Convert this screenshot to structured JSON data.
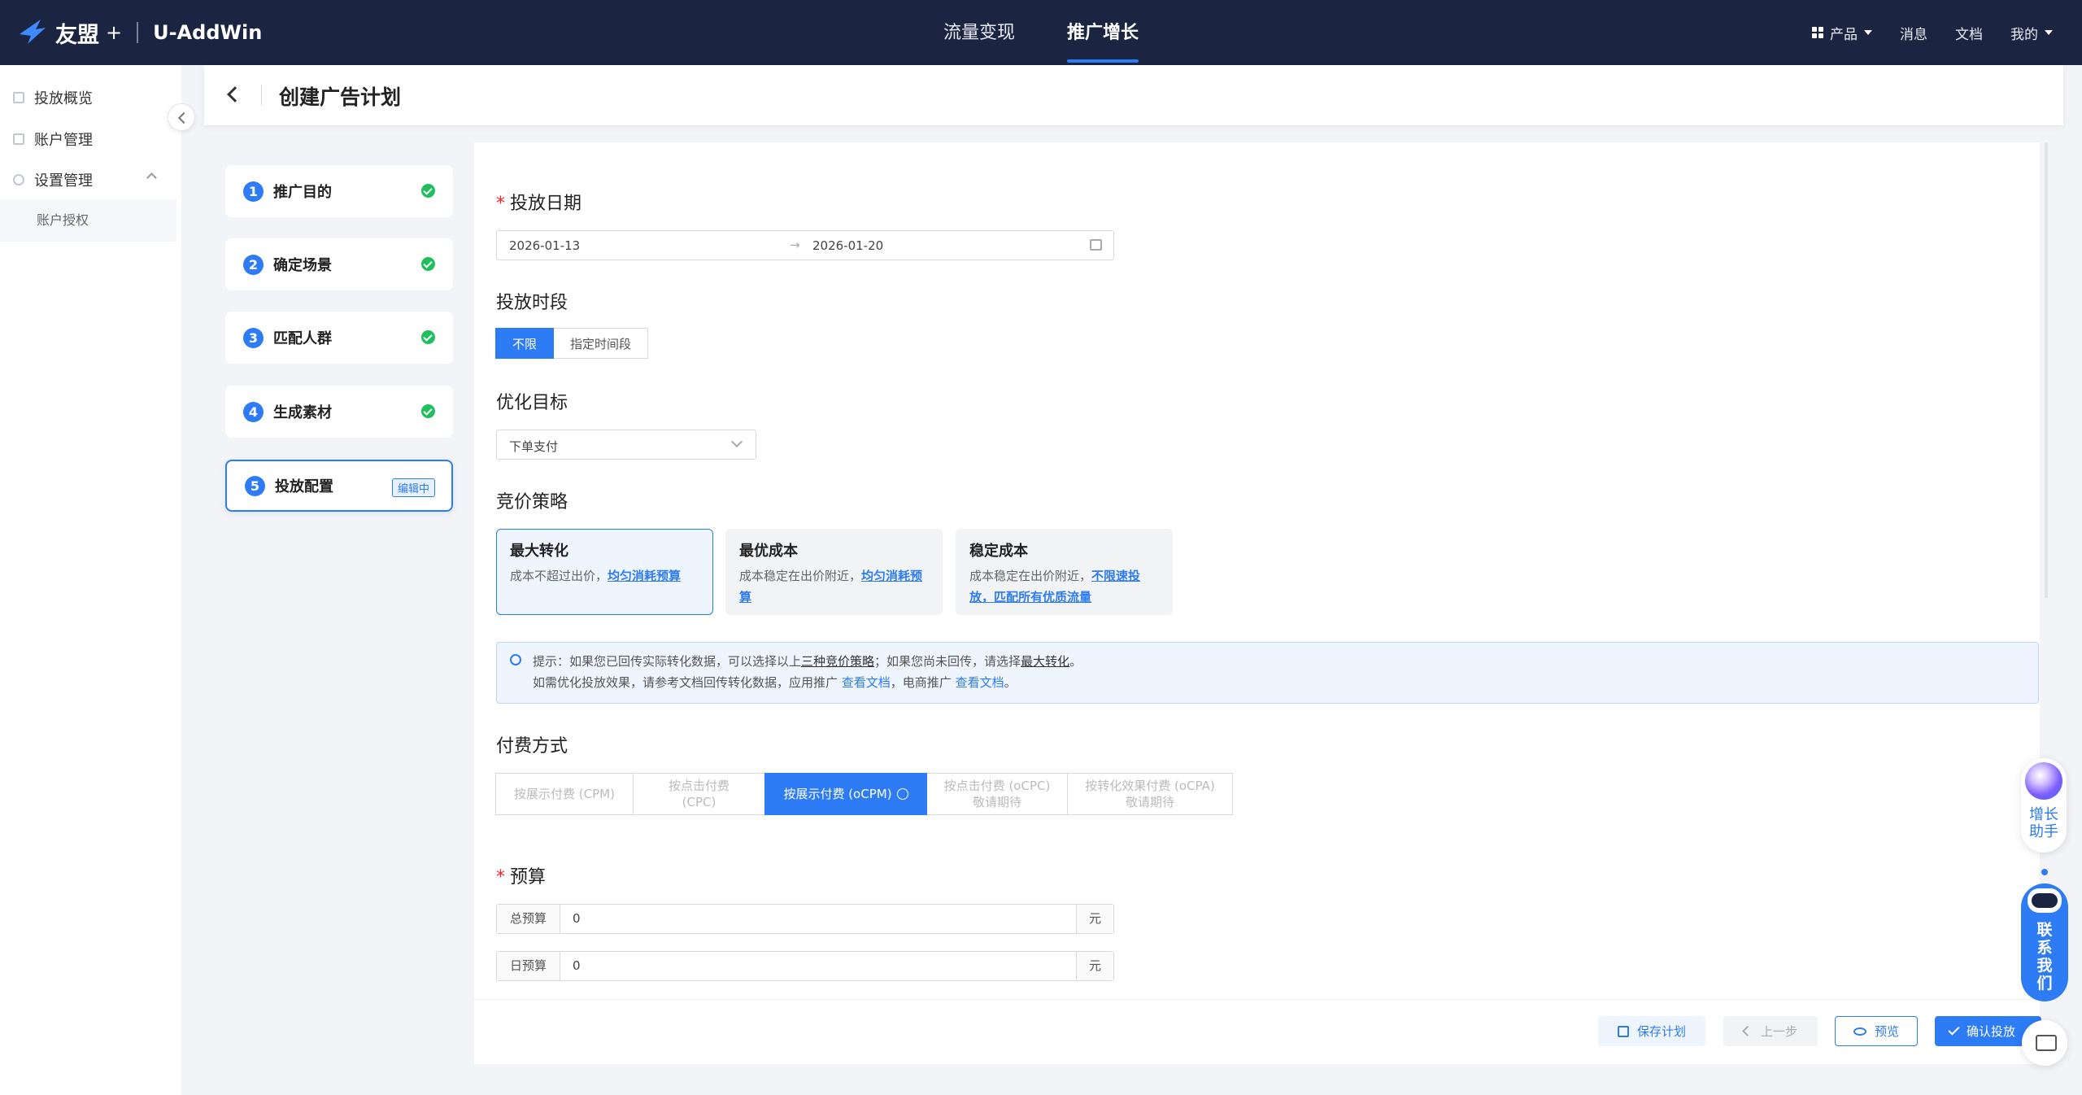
{
  "topbar": {
    "brand": "友盟",
    "plus": "+",
    "product": "U-AddWin",
    "nav": [
      "流量变现",
      "推广增长"
    ],
    "active_nav": "推广增长",
    "right": {
      "product_menu": "产品",
      "messages": "消息",
      "docs": "文档",
      "mine": "我的"
    }
  },
  "sidebar": {
    "items": [
      {
        "label": "投放概览",
        "icon": "list-icon"
      },
      {
        "label": "账户管理",
        "icon": "account-icon"
      },
      {
        "label": "设置管理",
        "icon": "settings-icon"
      }
    ],
    "sub_items": [
      "账户授权"
    ]
  },
  "header": {
    "title": "创建广告计划"
  },
  "steps": [
    {
      "num": "1",
      "label": "推广目的",
      "status": "done"
    },
    {
      "num": "2",
      "label": "确定场景",
      "status": "done"
    },
    {
      "num": "3",
      "label": "匹配人群",
      "status": "done"
    },
    {
      "num": "4",
      "label": "生成素材",
      "status": "done"
    },
    {
      "num": "5",
      "label": "投放配置",
      "status": "editing",
      "badge": "编辑中"
    }
  ],
  "form": {
    "date": {
      "label": "投放日期",
      "start": "2026-01-13",
      "end": "2026-01-20",
      "separator": "→"
    },
    "period": {
      "label": "投放时段",
      "options": [
        "不限",
        "指定时间段"
      ],
      "selected": "不限"
    },
    "goal": {
      "label": "优化目标",
      "value": "下单支付"
    },
    "bidding": {
      "label": "竞价策略",
      "cards": [
        {
          "title": "最大转化",
          "desc": "成本不超过出价，",
          "link": "均匀消耗预算",
          "selected": true
        },
        {
          "title": "最优成本",
          "desc": "成本稳定在出价附近，",
          "link": "均匀消耗预算",
          "selected": false
        },
        {
          "title": "稳定成本",
          "desc": "成本稳定在出价附近，",
          "link": "不限速投放，匹配所有优质流量",
          "selected": false
        }
      ]
    },
    "tip": {
      "l1a": "提示：如果您已回传实际转化数据，可以选择以上",
      "l1b": "三种竞价策略",
      "l1c": "；如果您尚未回传，请选择",
      "l1d": "最大转化",
      "l1e": "。",
      "l2a": "如需优化投放效果，请参考文档回传转化数据，应用推广 ",
      "l2b": "查看文档",
      "l2c": "，电商推广 ",
      "l2d": "查看文档",
      "l2e": "。"
    },
    "payment": {
      "label": "付费方式",
      "options": [
        {
          "label": "按展示付费 (CPM)",
          "state": "disabled"
        },
        {
          "label": "按点击付费 (CPC)",
          "state": "disabled"
        },
        {
          "label": "按展示付费 (oCPM)",
          "state": "selected"
        },
        {
          "label": "按点击付费 (oCPC)",
          "sub": "敬请期待",
          "state": "disabled"
        },
        {
          "label": "按转化效果付费 (oCPA)",
          "sub": "敬请期待",
          "state": "disabled"
        }
      ]
    },
    "budget": {
      "label": "预算",
      "total": {
        "prefix": "总预算",
        "value": "0",
        "suffix": "元"
      },
      "daily": {
        "prefix": "日预算",
        "value": "0",
        "suffix": "元"
      }
    }
  },
  "footer": {
    "save": "保存计划",
    "prev": "上一步",
    "preview": "预览",
    "confirm": "确认投放"
  },
  "widgets": {
    "assistant": "增长助手",
    "contact": "联系我们"
  },
  "colors": {
    "accent": "#2d7bf5",
    "topbar": "#1b2541",
    "success": "#1fbf5e"
  }
}
